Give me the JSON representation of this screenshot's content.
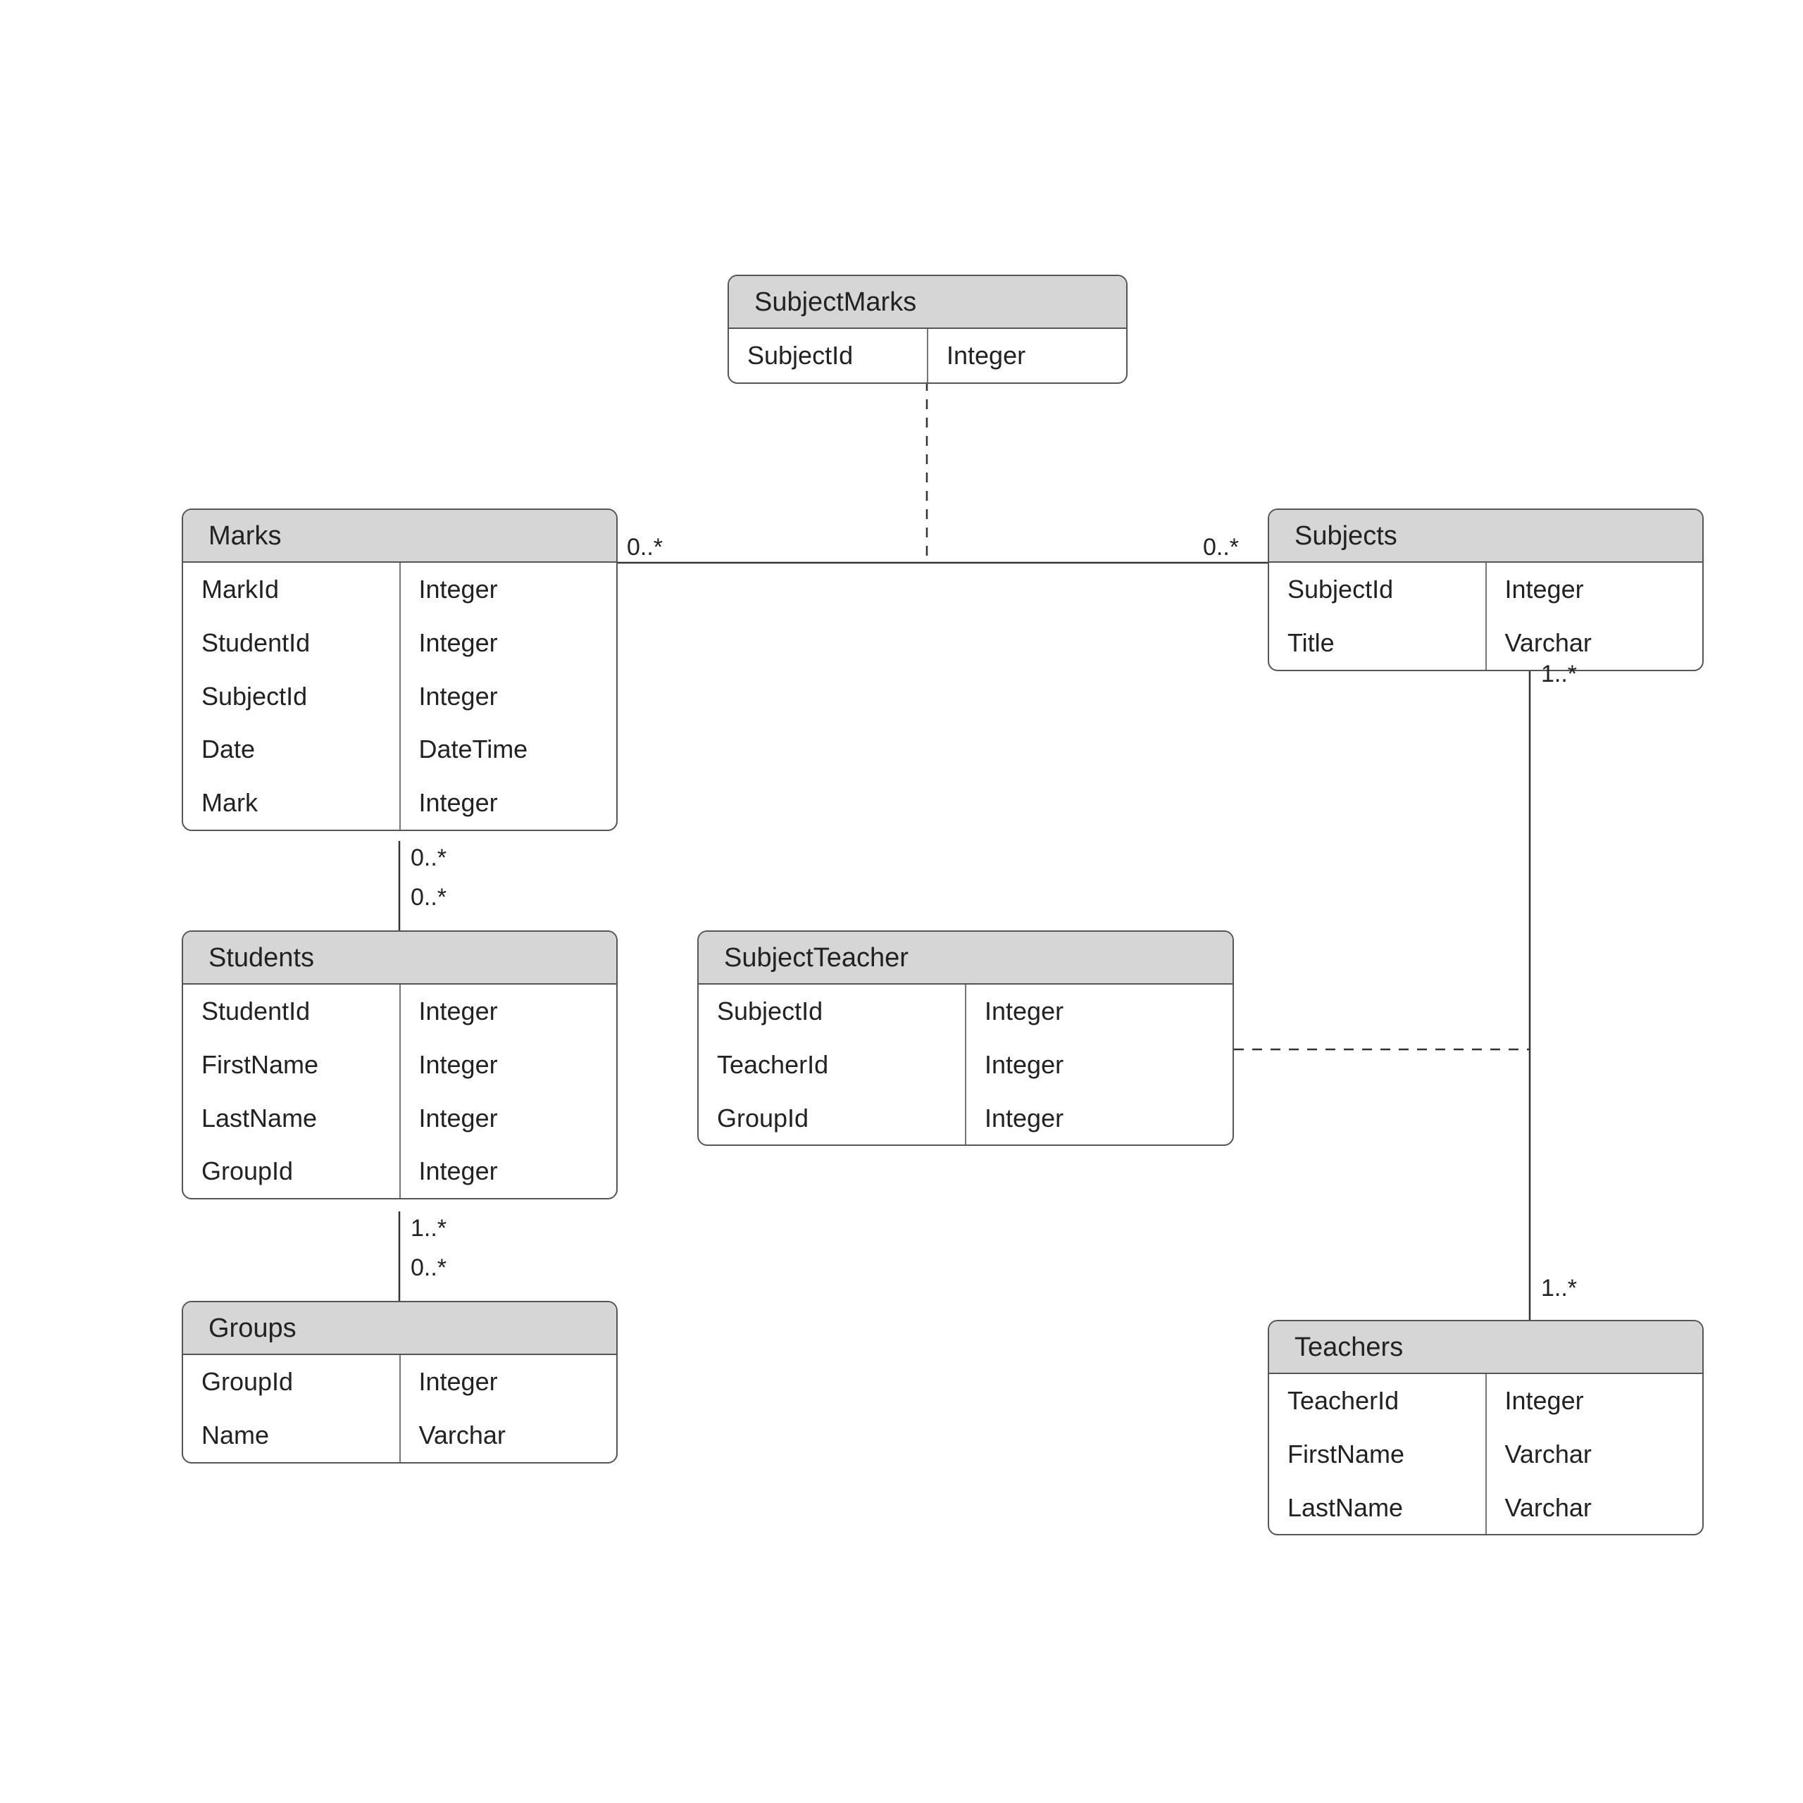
{
  "entities": {
    "subjectMarks": {
      "name": "SubjectMarks",
      "fields": [
        {
          "name": "SubjectId",
          "type": "Integer"
        }
      ]
    },
    "marks": {
      "name": "Marks",
      "fields": [
        {
          "name": "MarkId",
          "type": "Integer"
        },
        {
          "name": "StudentId",
          "type": "Integer"
        },
        {
          "name": "SubjectId",
          "type": "Integer"
        },
        {
          "name": "Date",
          "type": "DateTime"
        },
        {
          "name": "Mark",
          "type": "Integer"
        }
      ]
    },
    "subjects": {
      "name": "Subjects",
      "fields": [
        {
          "name": "SubjectId",
          "type": "Integer"
        },
        {
          "name": "Title",
          "type": "Varchar"
        }
      ]
    },
    "students": {
      "name": "Students",
      "fields": [
        {
          "name": "StudentId",
          "type": "Integer"
        },
        {
          "name": "FirstName",
          "type": "Integer"
        },
        {
          "name": "LastName",
          "type": "Integer"
        },
        {
          "name": "GroupId",
          "type": "Integer"
        }
      ]
    },
    "subjectTeacher": {
      "name": "SubjectTeacher",
      "fields": [
        {
          "name": "SubjectId",
          "type": "Integer"
        },
        {
          "name": "TeacherId",
          "type": "Integer"
        },
        {
          "name": "GroupId",
          "type": "Integer"
        }
      ]
    },
    "groups": {
      "name": "Groups",
      "fields": [
        {
          "name": "GroupId",
          "type": "Integer"
        },
        {
          "name": "Name",
          "type": "Varchar"
        }
      ]
    },
    "teachers": {
      "name": "Teachers",
      "fields": [
        {
          "name": "TeacherId",
          "type": "Integer"
        },
        {
          "name": "FirstName",
          "type": "Varchar"
        },
        {
          "name": "LastName",
          "type": "Varchar"
        }
      ]
    }
  },
  "multiplicities": {
    "marksToSubjects_left": "0..*",
    "marksToSubjects_right": "0..*",
    "marksToStudents_top": "0..*",
    "marksToStudents_bottom": "0..*",
    "studentsToGroups_top": "1..*",
    "studentsToGroups_bottom": "0..*",
    "subjectsToTeachers_top": "1..*",
    "subjectsToTeachers_bottom": "1..*"
  },
  "relationships": [
    {
      "from": "Marks",
      "to": "Subjects",
      "leftMult": "0..*",
      "rightMult": "0..*",
      "associationClass": "SubjectMarks"
    },
    {
      "from": "Marks",
      "to": "Students",
      "leftMult": "0..*",
      "rightMult": "0..*"
    },
    {
      "from": "Students",
      "to": "Groups",
      "leftMult": "1..*",
      "rightMult": "0..*"
    },
    {
      "from": "Subjects",
      "to": "Teachers",
      "leftMult": "1..*",
      "rightMult": "1..*",
      "associationClass": "SubjectTeacher"
    }
  ]
}
